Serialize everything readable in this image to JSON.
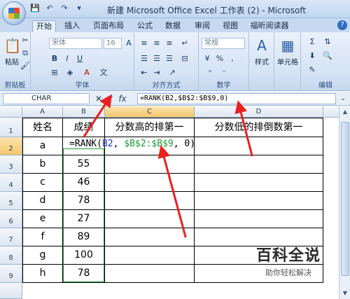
{
  "window": {
    "title": "新建 Microsoft Office Excel 工作表 (2) - Microsoft"
  },
  "tabs": [
    "开始",
    "插入",
    "页面布局",
    "公式",
    "数据",
    "审阅",
    "视图",
    "福昕阅读器"
  ],
  "ribbon": {
    "groups": [
      "剪贴板",
      "字体",
      "对齐方式",
      "数字",
      "编辑"
    ],
    "paste_label": "粘贴",
    "font_name": "宋体",
    "font_size": "16",
    "number_format": "常规",
    "style_label": "样式",
    "cells_label": "单元格"
  },
  "formula_bar": {
    "name_box": "CHAR",
    "formula": "=RANK(B2,$B$2:$B$9,0)"
  },
  "grid": {
    "columns": [
      "A",
      "B",
      "C",
      "D"
    ],
    "rows": [
      "1",
      "2",
      "3",
      "4",
      "5",
      "6",
      "7",
      "8",
      "9"
    ],
    "header": [
      "姓名",
      "成绩",
      "分数高的排第一",
      "分数低的排倒数第一"
    ],
    "names": [
      "a",
      "b",
      "c",
      "d",
      "e",
      "f",
      "g",
      "h"
    ],
    "scores": [
      "",
      "55",
      "46",
      "78",
      "27",
      "89",
      "100",
      "78"
    ],
    "editing_formula": {
      "prefix": "=RANK(",
      "ref1": "B2",
      "sep1": ", ",
      "ref2": "$B$2:$B$9",
      "suffix": ", 0)"
    }
  },
  "watermark": {
    "title": "百科全说",
    "subtitle": "助你轻松解决"
  }
}
